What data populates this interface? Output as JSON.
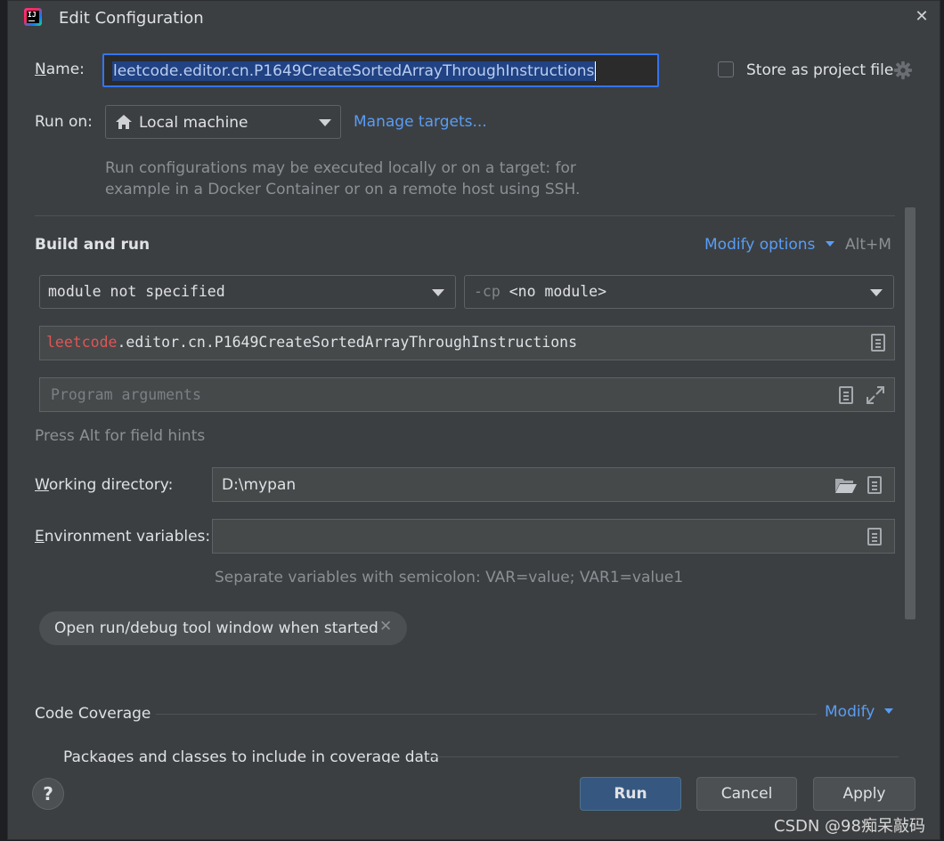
{
  "window": {
    "title": "Edit Configuration",
    "close_icon": "close-icon"
  },
  "name": {
    "label_underlined": "N",
    "label_rest": "ame:",
    "value": "leetcode.editor.cn.P1649CreateSortedArrayThroughInstructions"
  },
  "store_as_project_file": {
    "label": "Store as project file",
    "checked": false
  },
  "run_on": {
    "label": "Run on:",
    "selected": "Local machine",
    "manage_link": "Manage targets...",
    "hint_line1": "Run configurations may be executed locally or on a target: for",
    "hint_line2": "example in a Docker Container or on a remote host using SSH."
  },
  "build_and_run": {
    "heading": "Build and run",
    "modify_options": "Modify options",
    "shortcut": "Alt+M",
    "module_select": "module not specified",
    "cp_prefix": "-cp",
    "cp_value": "<no module>",
    "main_class_part1": "leetcode",
    "main_class_part2": ".editor.cn.P1649CreateSortedArrayThroughInstructions",
    "program_args_placeholder": "Program arguments",
    "field_hint": "Press Alt for field hints"
  },
  "working_directory": {
    "label_underlined": "W",
    "label_rest": "orking directory:",
    "value": "D:\\mypan"
  },
  "environment_variables": {
    "label_underlined": "E",
    "label_rest": "nvironment variables:",
    "value": "",
    "hint": "Separate variables with semicolon: VAR=value; VAR1=value1"
  },
  "chip": {
    "label": "Open run/debug tool window when started"
  },
  "code_coverage": {
    "heading": "Code Coverage",
    "modify": "Modify",
    "packages_text": "Packages and classes to include in coverage data"
  },
  "buttons": {
    "run": "Run",
    "cancel": "Cancel",
    "apply": "Apply",
    "help": "?"
  },
  "watermark": "CSDN @98痴呆敲码",
  "colors": {
    "accent": "#589df6",
    "primary_button": "#365880",
    "error_red": "#e05555"
  }
}
